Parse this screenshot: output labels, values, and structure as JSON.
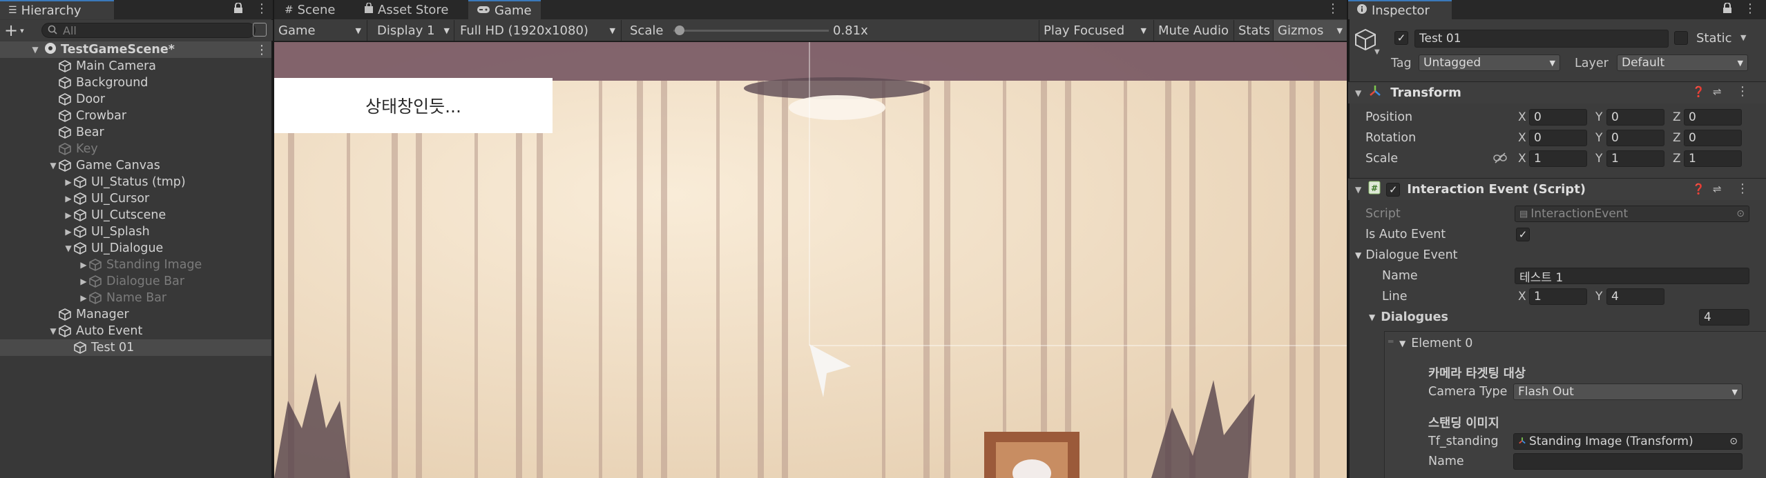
{
  "hierarchy": {
    "tab_label": "Hierarchy",
    "search_placeholder": "All",
    "add_label": "+",
    "scene_name": "TestGameScene*",
    "items": [
      {
        "label": "Main Camera"
      },
      {
        "label": "Background"
      },
      {
        "label": "Door"
      },
      {
        "label": "Crowbar"
      },
      {
        "label": "Bear"
      },
      {
        "label": "Key"
      },
      {
        "label": "Game Canvas"
      },
      {
        "label": "UI_Status (tmp)"
      },
      {
        "label": "UI_Cursor"
      },
      {
        "label": "UI_Cutscene"
      },
      {
        "label": "UI_Splash"
      },
      {
        "label": "UI_Dialogue"
      },
      {
        "label": "Standing Image"
      },
      {
        "label": "Dialogue Bar"
      },
      {
        "label": "Name Bar"
      },
      {
        "label": "Manager"
      },
      {
        "label": "Auto Event"
      },
      {
        "label": "Test 01"
      }
    ]
  },
  "center_tabs": {
    "scene": "Scene",
    "asset_store": "Asset Store",
    "game": "Game"
  },
  "game_toolbar": {
    "display_mode": "Game",
    "display": "Display 1",
    "resolution": "Full HD (1920x1080)",
    "scale_label": "Scale",
    "scale_value": "0.81x",
    "scale_fraction": 0.04,
    "play_mode": "Play Focused",
    "mute": "Mute Audio",
    "stats": "Stats",
    "gizmos": "Gizmos"
  },
  "game_view": {
    "status_text": "상태창인듯..."
  },
  "inspector": {
    "tab_label": "Inspector",
    "object_name": "Test 01",
    "static_label": "Static",
    "tag_label": "Tag",
    "tag_value": "Untagged",
    "layer_label": "Layer",
    "layer_value": "Default",
    "transform": {
      "title": "Transform",
      "position_label": "Position",
      "rotation_label": "Rotation",
      "scale_label": "Scale",
      "position": {
        "x": "0",
        "y": "0",
        "z": "0"
      },
      "rotation": {
        "x": "0",
        "y": "0",
        "z": "0"
      },
      "scale": {
        "x": "1",
        "y": "1",
        "z": "1"
      }
    },
    "script_component": {
      "title": "Interaction Event (Script)",
      "script_label": "Script",
      "script_value": "InteractionEvent",
      "auto_event_label": "Is Auto Event",
      "dialogue_event_label": "Dialogue Event",
      "name_label": "Name",
      "name_value": "테스트 1",
      "line_label": "Line",
      "line_x": "1",
      "line_y": "4",
      "dialogues_label": "Dialogues",
      "dialogues_count": "4",
      "element_label": "Element 0",
      "camera_header": "카메라 타겟팅 대상",
      "camera_type_label": "Camera Type",
      "camera_type_value": "Flash Out",
      "standing_header": "스탠딩 이미지",
      "tf_standing_label": "Tf_standing",
      "tf_standing_value": "Standing Image (Transform)",
      "element_name_label": "Name"
    },
    "axis": {
      "x": "X",
      "y": "Y",
      "z": "Z"
    }
  }
}
